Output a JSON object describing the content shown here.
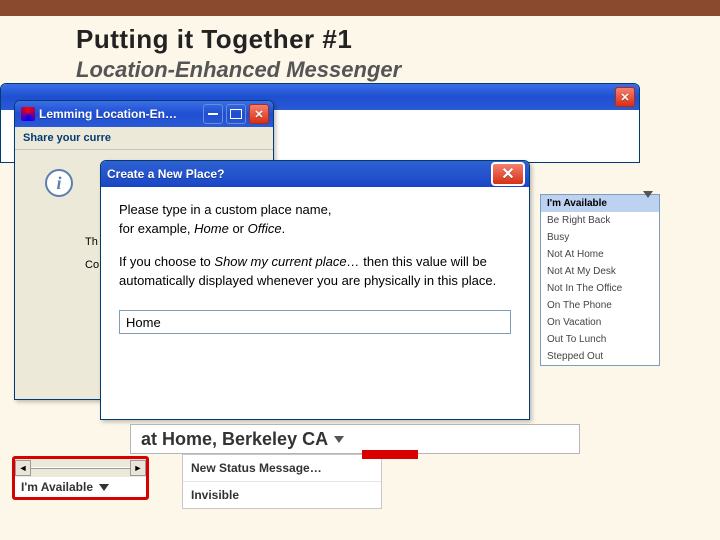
{
  "slide": {
    "title": "Putting it Together #1",
    "subtitle": "Location-Enhanced Messenger"
  },
  "w1": {
    "title": "Lemming Location-En…",
    "menu": "Share your curre",
    "body_p1_frag": "Th\nsh\nFo",
    "body_p2_frag": "Co"
  },
  "w2": {
    "title": "Create a New Place?",
    "line1_pre": "Please type in a custom place name,",
    "line1_post_pre": "for example, ",
    "line1_ex1": "Home",
    "line1_mid": " or ",
    "line1_ex2": "Office",
    "line1_end": ".",
    "line2_pre": "If you choose to ",
    "line2_em": "Show my current place…",
    "line2_post": " then this value will be automatically displayed whenever you are physically in this place.",
    "input_value": "Home"
  },
  "location_label": "at Home, Berkeley CA",
  "status_options": [
    "I'm Available",
    "Be Right Back",
    "Busy",
    "Not At Home",
    "Not At My Desk",
    "Not In The Office",
    "On The Phone",
    "On Vacation",
    "Out To Lunch",
    "Stepped Out"
  ],
  "status_selected": "I'm Available",
  "extra": {
    "item1": "New Status Message…",
    "item2": "Invisible"
  }
}
